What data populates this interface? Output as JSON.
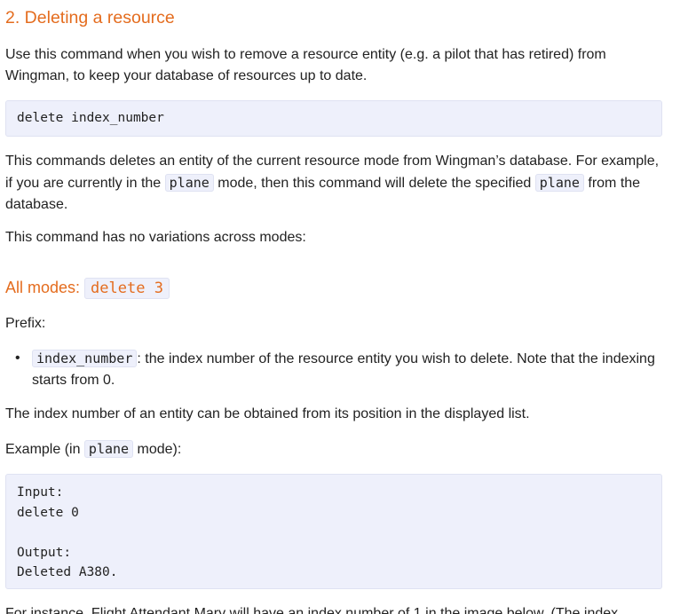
{
  "section": {
    "title": "2. Deleting a resource"
  },
  "intro": {
    "text": "Use this command when you wish to remove a resource entity (e.g. a pilot that has retired) from Wingman, to keep your database of resources up to date."
  },
  "syntax_block": {
    "code": "delete index_number"
  },
  "description": {
    "part1": "This commands deletes an entity of the current resource mode from Wingman’s database. For example, if you are currently in the ",
    "code1": "plane",
    "part2": " mode, then this command will delete the specified ",
    "code2": "plane",
    "part3": " from the database."
  },
  "variations_note": "This command has no variations across modes:",
  "all_modes": {
    "label": "All modes: ",
    "code": "delete 3"
  },
  "prefix_label": "Prefix:",
  "params": [
    {
      "bullet": "•",
      "code": "index_number",
      "text": ": the index number of the resource entity you wish to delete. Note that the indexing starts from 0."
    }
  ],
  "index_note": "The index number of an entity can be obtained from its position in the displayed list.",
  "example": {
    "prefix": "Example (in ",
    "code": "plane",
    "suffix": " mode):"
  },
  "example_block": {
    "code": "Input:\ndelete 0\n\nOutput:\nDeleted A380."
  },
  "footer_text": "For instance, Flight Attendant Mary will have an index number of 1 in the image below. (The index"
}
